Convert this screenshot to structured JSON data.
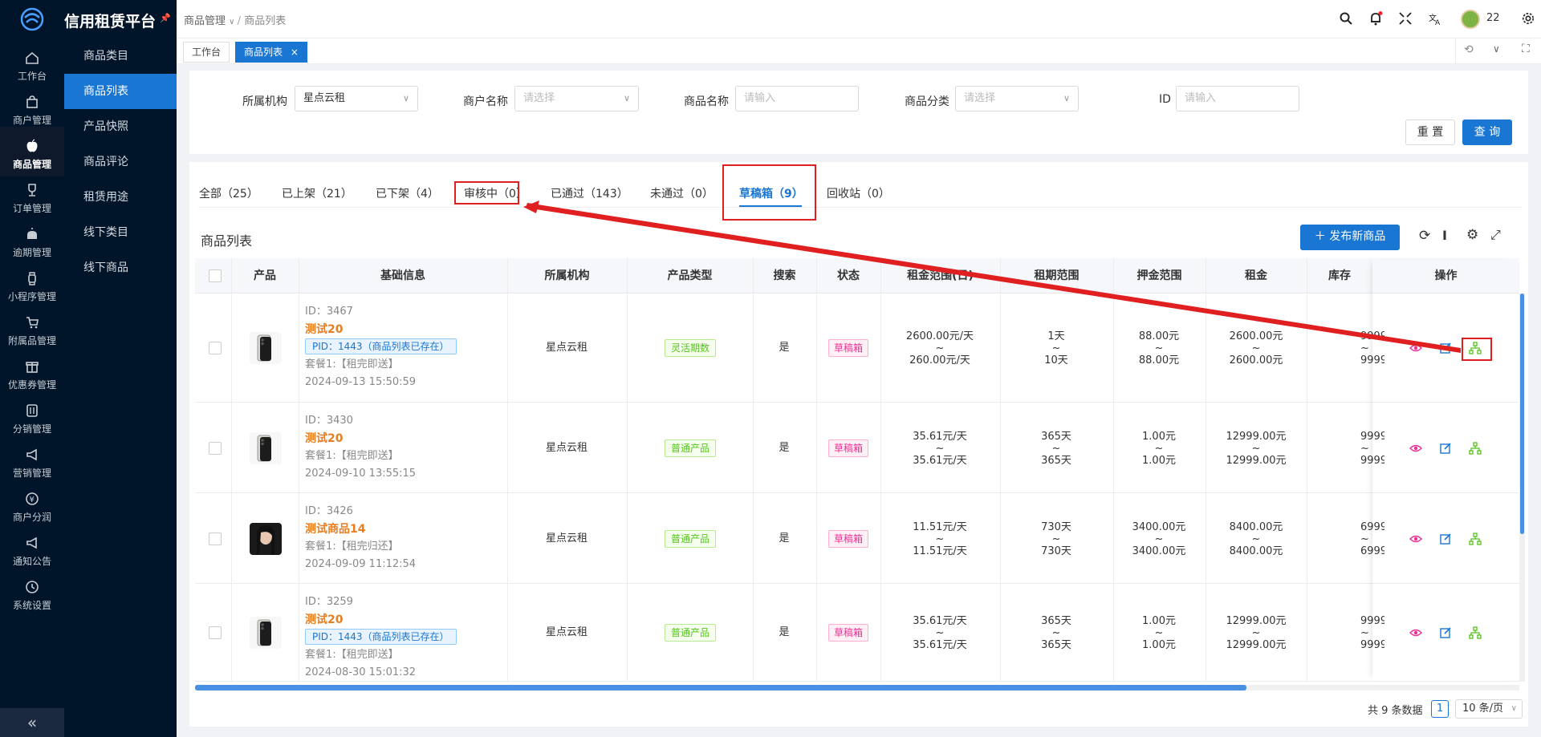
{
  "app": {
    "title": "信用租赁平台"
  },
  "mainnav": [
    {
      "label": "工作台",
      "icon": "home-icon"
    },
    {
      "label": "商户管理",
      "icon": "shop-bag-icon"
    },
    {
      "label": "商品管理",
      "icon": "apple-icon"
    },
    {
      "label": "订单管理",
      "icon": "trophy-icon"
    },
    {
      "label": "逾期管理",
      "icon": "alarm-icon"
    },
    {
      "label": "小程序管理",
      "icon": "watch-icon"
    },
    {
      "label": "附属品管理",
      "icon": "cart-icon"
    },
    {
      "label": "优惠券管理",
      "icon": "gift-icon"
    },
    {
      "label": "分销管理",
      "icon": "sliders-icon"
    },
    {
      "label": "营销管理",
      "icon": "megaphone-icon"
    },
    {
      "label": "商户分润",
      "icon": "yen-icon"
    },
    {
      "label": "通知公告",
      "icon": "notice-icon"
    },
    {
      "label": "系统设置",
      "icon": "clock-icon"
    }
  ],
  "subnav": [
    "商品类目",
    "商品列表",
    "产品快照",
    "商品评论",
    "租赁用途",
    "线下类目",
    "线下商品"
  ],
  "breadcrumb": {
    "first": "商品管理",
    "sep": "/",
    "second": "商品列表"
  },
  "user": {
    "name": "22"
  },
  "pagetabs": [
    {
      "label": "工作台"
    },
    {
      "label": "商品列表",
      "close": "×"
    }
  ],
  "filters": {
    "org_label": "所属机构",
    "org_value": "星点云租",
    "merchant_label": "商户名称",
    "merchant_placeholder": "请选择",
    "product_label": "商品名称",
    "product_placeholder": "请输入",
    "category_label": "商品分类",
    "category_placeholder": "请选择",
    "id_label": "ID",
    "id_placeholder": "请输入",
    "reset": "重 置",
    "query": "查 询"
  },
  "status_tabs": [
    "全部（25）",
    "已上架（21）",
    "已下架（4）",
    "审核中（0）",
    "已通过（143）",
    "未通过（0）",
    "草稿箱（9）",
    "回收站（0）"
  ],
  "list": {
    "title": "商品列表",
    "publish": "发布新商品"
  },
  "columns": [
    "产品",
    "基础信息",
    "所属机构",
    "产品类型",
    "搜索",
    "状态",
    "租金范围(日)",
    "租期范围",
    "押金范围",
    "租金",
    "库存",
    "操作"
  ],
  "rows": [
    {
      "id": "ID：3467",
      "name": "测试20",
      "pid": "PID：1443（商品列表已存在）",
      "plan": "套餐1:【租完即送】",
      "date": "2024-09-13 15:50:59",
      "org": "星点云租",
      "type": "灵活期数",
      "search": "是",
      "status": "草稿箱",
      "daily": [
        "2600.00元/天",
        "~",
        "260.00元/天"
      ],
      "term": [
        "1天",
        "~",
        "10天"
      ],
      "deposit": [
        "88.00元",
        "~",
        "88.00元"
      ],
      "rent": [
        "2600.00元",
        "~",
        "2600.00元"
      ],
      "stock": [
        "9999",
        "~",
        "9999"
      ],
      "thumb": "phone"
    },
    {
      "id": "ID：3430",
      "name": "测试20",
      "pid": "",
      "plan": "套餐1:【租完即送】",
      "date": "2024-09-10 13:55:15",
      "org": "星点云租",
      "type": "普通产品",
      "search": "是",
      "status": "草稿箱",
      "daily": [
        "35.61元/天",
        "~",
        "35.61元/天"
      ],
      "term": [
        "365天",
        "~",
        "365天"
      ],
      "deposit": [
        "1.00元",
        "~",
        "1.00元"
      ],
      "rent": [
        "12999.00元",
        "~",
        "12999.00元"
      ],
      "stock": [
        "9999",
        "~",
        "9999"
      ],
      "thumb": "phone"
    },
    {
      "id": "ID：3426",
      "name": "测试商品14",
      "pid": "",
      "plan": "套餐1:【租完归还】",
      "date": "2024-09-09 11:12:54",
      "org": "星点云租",
      "type": "普通产品",
      "search": "是",
      "status": "草稿箱",
      "daily": [
        "11.51元/天",
        "~",
        "11.51元/天"
      ],
      "term": [
        "730天",
        "~",
        "730天"
      ],
      "deposit": [
        "3400.00元",
        "~",
        "3400.00元"
      ],
      "rent": [
        "8400.00元",
        "~",
        "8400.00元"
      ],
      "stock": [
        "6999",
        "~",
        "6999"
      ],
      "thumb": "portrait"
    },
    {
      "id": "ID：3259",
      "name": "测试20",
      "pid": "PID：1443（商品列表已存在）",
      "plan": "套餐1:【租完即送】",
      "date": "2024-08-30 15:01:32",
      "org": "星点云租",
      "type": "普通产品",
      "search": "是",
      "status": "草稿箱",
      "daily": [
        "35.61元/天",
        "~",
        "35.61元/天"
      ],
      "term": [
        "365天",
        "~",
        "365天"
      ],
      "deposit": [
        "1.00元",
        "~",
        "1.00元"
      ],
      "rent": [
        "12999.00元",
        "~",
        "12999.00元"
      ],
      "stock": [
        "9999",
        "~",
        "9999"
      ],
      "thumb": "phone"
    }
  ],
  "pagination": {
    "total": "共 9 条数据",
    "page": "1",
    "page_size": "10 条/页"
  },
  "colors": {
    "primary": "#1976d2",
    "nav": "#001529",
    "annotation": "#e02020"
  }
}
